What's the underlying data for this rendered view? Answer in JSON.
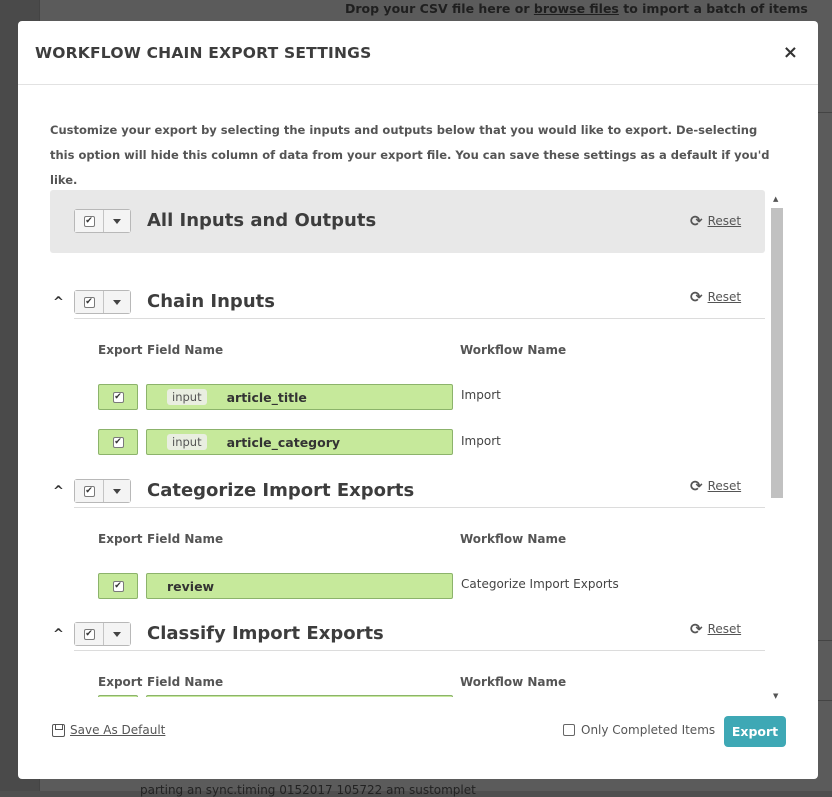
{
  "background": {
    "top_text_before": "Drop your CSV file here or ",
    "top_text_link": "browse files",
    "top_text_after": " to import a batch of items",
    "bottom_text": "parting an sync.timing 0152017 105722 am sustomplet"
  },
  "modal": {
    "title": "WORKFLOW CHAIN EXPORT SETTINGS",
    "close_glyph": "×",
    "intro": "Customize your export by selecting the inputs and outputs below that you would like to export. De-selecting this option will hide this column of data from your export file. You can save these settings as a default if you'd like.",
    "reset_label": "Reset",
    "reset_icon": "refresh-icon",
    "check_glyph": "✔",
    "collapse_glyph": "^",
    "all": {
      "title": "All Inputs and Outputs"
    },
    "columns": {
      "export": "Export",
      "field": "Field Name",
      "workflow": "Workflow Name"
    },
    "sections": [
      {
        "title": "Chain Inputs",
        "rows": [
          {
            "tag": "input",
            "field": "article_title",
            "workflow": "Import"
          },
          {
            "tag": "input",
            "field": "article_category",
            "workflow": "Import"
          }
        ]
      },
      {
        "title": "Categorize Import Exports",
        "rows": [
          {
            "tag": "",
            "field": "review",
            "workflow": "Categorize Import Exports"
          }
        ]
      },
      {
        "title": "Classify Import Exports",
        "rows": []
      }
    ],
    "footer": {
      "save_default": "Save As Default",
      "only_completed": "Only Completed Items",
      "export": "Export"
    },
    "colors": {
      "accent": "#3ea8b5",
      "row_green": "#c6e99b"
    }
  }
}
